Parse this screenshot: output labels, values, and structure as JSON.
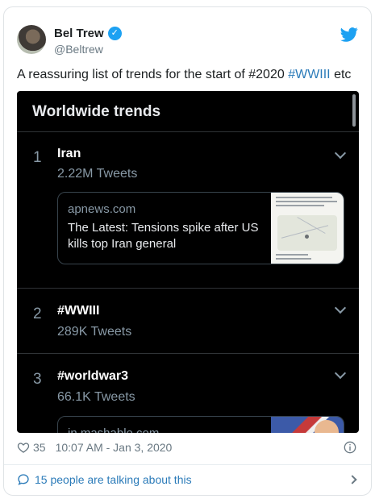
{
  "author": {
    "name": "Bel Trew",
    "handle": "@Beltrew",
    "verified_icon": "check-icon"
  },
  "tweet": {
    "text_before": "A reassuring list of trends for the start of #2020 ",
    "hashtag": "#WWIII",
    "text_after": " etc"
  },
  "embedded_screenshot": {
    "title": "Worldwide trends",
    "trends": [
      {
        "rank": "1",
        "name": "Iran",
        "count": "2.22M Tweets"
      },
      {
        "rank": "2",
        "name": "#WWIII",
        "count": "289K Tweets"
      },
      {
        "rank": "3",
        "name": "#worldwar3",
        "count": "66.1K Tweets"
      }
    ],
    "news_card": {
      "source": "apnews.com",
      "headline": "The Latest: Tensions spike after US kills top Iran general"
    },
    "second_card": {
      "source": "in.mashable.com"
    }
  },
  "footer": {
    "likes": "35",
    "timestamp": "10:07 AM - Jan 3, 2020",
    "talking": "15 people are talking about this"
  },
  "colors": {
    "link": "#2b7bb9",
    "twitter_blue": "#1da1f2",
    "dark_bg": "#000000"
  }
}
